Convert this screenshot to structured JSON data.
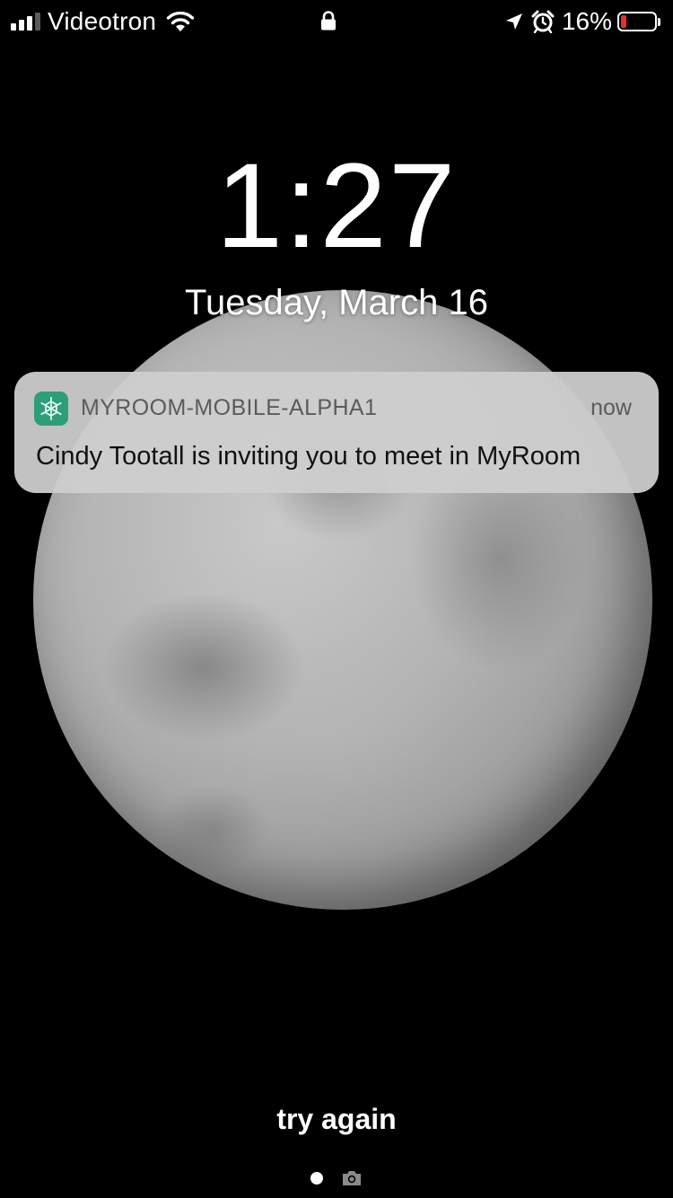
{
  "status_bar": {
    "carrier": "Videotron",
    "battery_percent": "16%",
    "battery_level": 0.16,
    "battery_color": "#e52f2f",
    "icons": [
      "signal-icon",
      "wifi-icon",
      "lock-icon",
      "location-icon",
      "alarm-icon",
      "battery-icon"
    ]
  },
  "lock_screen": {
    "time": "1:27",
    "date": "Tuesday, March 16"
  },
  "notification": {
    "app_name": "MYROOM-MOBILE-ALPHA1",
    "time": "now",
    "message": "Cindy Tootall is inviting you to meet in MyRoom",
    "icon": "myroom-app-icon",
    "icon_color": "#2e9e79"
  },
  "bottom": {
    "label": "try again",
    "icons": [
      "page-dot-icon",
      "camera-icon"
    ]
  }
}
